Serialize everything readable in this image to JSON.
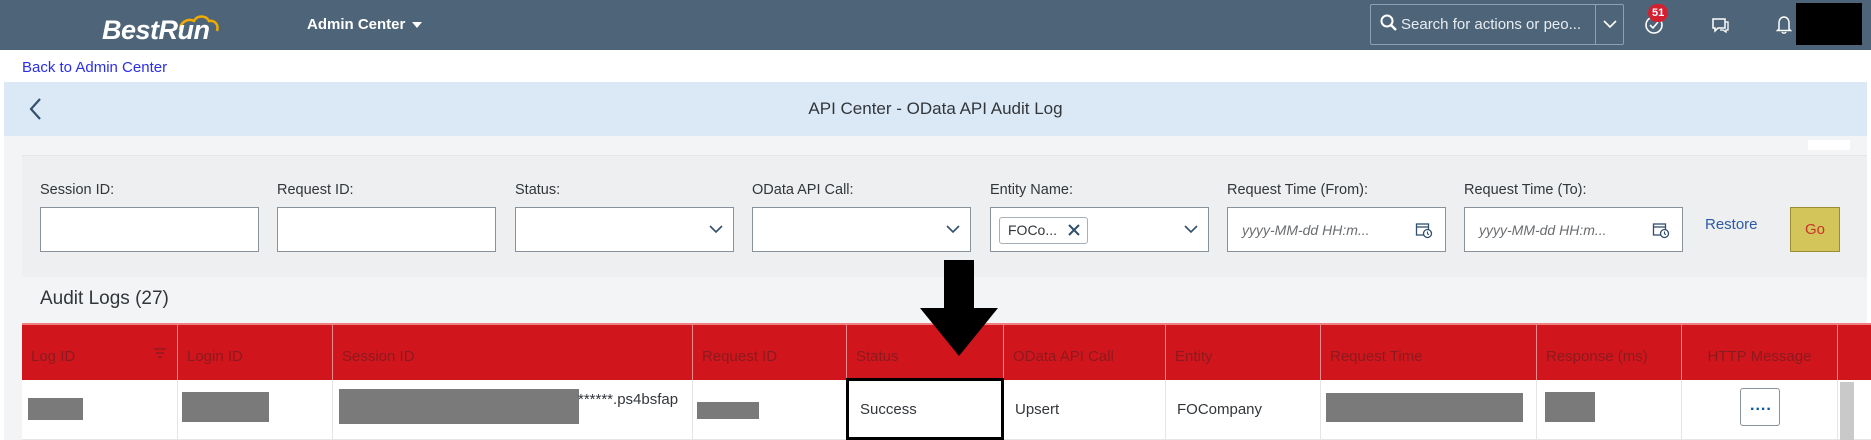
{
  "shell": {
    "logo_text": "BestRun",
    "app_menu_label": "Admin Center",
    "search_placeholder": "Search for actions or peo...",
    "notification_count": "51"
  },
  "back_link": "Back to Admin Center",
  "page_title": "API Center - OData API Audit Log",
  "filters": {
    "session_id_label": "Session ID:",
    "request_id_label": "Request ID:",
    "status_label": "Status:",
    "odata_call_label": "OData API Call:",
    "entity_name_label": "Entity Name:",
    "entity_token": "FOCo...",
    "time_from_label": "Request Time (From):",
    "time_to_label": "Request Time (To):",
    "date_placeholder": "yyyy-MM-dd HH:m...",
    "restore_label": "Restore",
    "go_label": "Go"
  },
  "audit_logs_title": "Audit Logs (27)",
  "table": {
    "columns": [
      "Log ID",
      "Login ID",
      "Session ID",
      "Request ID",
      "Status",
      "OData API Call",
      "Entity",
      "Request Time",
      "Response (ms)",
      "HTTP Message"
    ],
    "rows": [
      {
        "session_id_suffix": "******.ps4bsfap",
        "status": "Success",
        "odata_api_call": "Upsert",
        "entity": "FOCompany",
        "http_message": "...."
      }
    ]
  },
  "colors": {
    "shell": "#4e6579",
    "header_red": "#d0161c",
    "go_button": "#d4c55a",
    "title_bar": "#dbe9f7"
  }
}
